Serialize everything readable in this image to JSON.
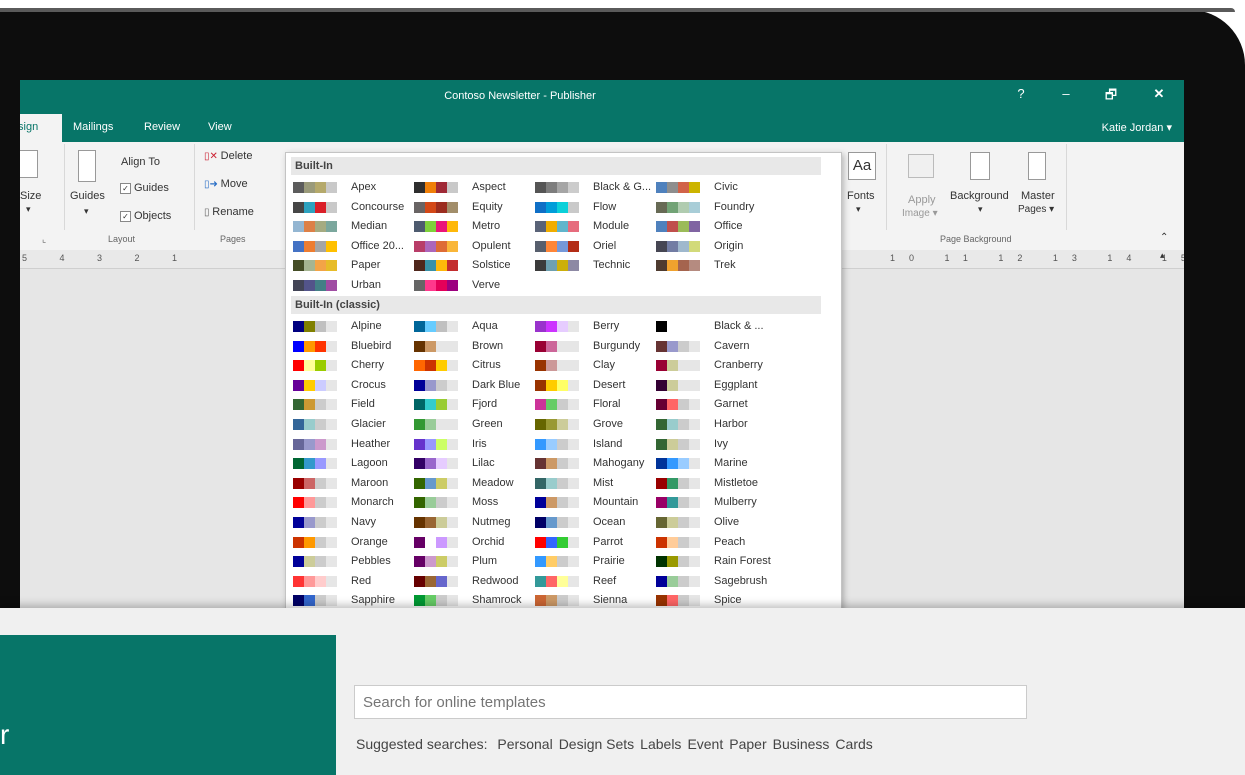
{
  "window": {
    "title": "Contoso Newsletter - Publisher",
    "help": "?",
    "minimize": "–",
    "restore": "🗗",
    "close": "✕"
  },
  "tabs": [
    {
      "label": "Design"
    },
    {
      "label": "Mailings"
    },
    {
      "label": "Review"
    },
    {
      "label": "View"
    }
  ],
  "user": "Katie Jordan ▾",
  "ribbon": {
    "size_label": "Size",
    "guides_label": "Guides",
    "align_to": "Align To",
    "guides_check": "Guides",
    "objects_check": "Objects",
    "layout_group": "Layout",
    "delete_label": "Delete",
    "move_label": "Move",
    "rename_label": "Rename",
    "pages_group": "Pages",
    "fonts_icon_text": "Aa",
    "fonts_label": "Fonts",
    "apply_image_label1": "Apply",
    "apply_image_label2": "Image ▾",
    "background_label": "Background",
    "master_pages_label1": "Master",
    "master_pages_label2": "Pages ▾",
    "page_background_group": "Page Background"
  },
  "ruler": {
    "left": "5  4  3  2  1",
    "right": "10  11  12  13  14  15"
  },
  "colors": {
    "accent": "#077568"
  },
  "dropdown": {
    "builtin_header": "Built-In",
    "classic_header": "Built-In (classic)",
    "builtin": [
      {
        "name": "Apex",
        "colors": [
          "#5c5c5c",
          "#9a9a7a",
          "#b5a96b",
          "#c9c9c9"
        ]
      },
      {
        "name": "Aspect",
        "colors": [
          "#2e2e2e",
          "#f07f09",
          "#9f2936",
          "#c9c9c9"
        ]
      },
      {
        "name": "Black & G...",
        "colors": [
          "#555555",
          "#7d7d7d",
          "#a5a5a5",
          "#cccccc"
        ]
      },
      {
        "name": "Civic",
        "colors": [
          "#4f81bd",
          "#8e8e8e",
          "#d16349",
          "#ccb400"
        ]
      },
      {
        "name": "Concourse",
        "colors": [
          "#464646",
          "#2da2bf",
          "#da1f28",
          "#c9c9c9"
        ]
      },
      {
        "name": "Equity",
        "colors": [
          "#696464",
          "#d34817",
          "#9b2d1f",
          "#a28e6a"
        ]
      },
      {
        "name": "Flow",
        "colors": [
          "#0f6fc6",
          "#009dd9",
          "#0bd0d9",
          "#c9c9c9"
        ]
      },
      {
        "name": "Foundry",
        "colors": [
          "#676a55",
          "#72a376",
          "#b0ccb0",
          "#a8cdd7"
        ]
      },
      {
        "name": "Median",
        "colors": [
          "#94b6d2",
          "#dd8047",
          "#a5ab81",
          "#7ba79d"
        ]
      },
      {
        "name": "Metro",
        "colors": [
          "#4e5b6f",
          "#7fd13b",
          "#ea157a",
          "#feb80a"
        ]
      },
      {
        "name": "Module",
        "colors": [
          "#5a6378",
          "#f0ad00",
          "#60b5cc",
          "#e66c7d"
        ]
      },
      {
        "name": "Office",
        "colors": [
          "#4f81bd",
          "#c0504d",
          "#9bbb59",
          "#8064a2"
        ]
      },
      {
        "name": "Office 20...",
        "colors": [
          "#4472c4",
          "#ed7d31",
          "#a5a5a5",
          "#ffc000"
        ]
      },
      {
        "name": "Opulent",
        "colors": [
          "#b83d68",
          "#ac66bb",
          "#de6c36",
          "#f9b639"
        ]
      },
      {
        "name": "Oriel",
        "colors": [
          "#575f6d",
          "#fe8637",
          "#7598d9",
          "#b32c16"
        ]
      },
      {
        "name": "Origin",
        "colors": [
          "#464653",
          "#727ca3",
          "#9fb8cd",
          "#d2da7a"
        ]
      },
      {
        "name": "Paper",
        "colors": [
          "#444d26",
          "#a5b592",
          "#f3a447",
          "#e7bc29"
        ]
      },
      {
        "name": "Solstice",
        "colors": [
          "#4f271c",
          "#3891a7",
          "#feb80a",
          "#c32d2e"
        ]
      },
      {
        "name": "Technic",
        "colors": [
          "#3b3b3b",
          "#6ea0b0",
          "#ccaf0a",
          "#8d89a4"
        ]
      },
      {
        "name": "Trek",
        "colors": [
          "#4e3b30",
          "#f0a22e",
          "#a5644e",
          "#b58b80"
        ]
      },
      {
        "name": "Urban",
        "colors": [
          "#424456",
          "#53548a",
          "#438086",
          "#a04da3"
        ]
      },
      {
        "name": "Verve",
        "colors": [
          "#666666",
          "#ff388c",
          "#e40059",
          "#9c007f"
        ]
      }
    ],
    "classic": [
      {
        "name": "Alpine",
        "colors": [
          "#000080",
          "#808000",
          "#c0c0c0",
          "#e6e6e6"
        ]
      },
      {
        "name": "Aqua",
        "colors": [
          "#006699",
          "#66ccff",
          "#c0c0c0",
          "#e6e6e6"
        ]
      },
      {
        "name": "Berry",
        "colors": [
          "#9933cc",
          "#cc33ff",
          "#e6ccff",
          "#e6e6e6"
        ]
      },
      {
        "name": "Black & ...",
        "colors": [
          "#000000",
          "#ffffff",
          "#ffffff",
          "#ffffff"
        ]
      },
      {
        "name": "Bluebird",
        "colors": [
          "#0000ff",
          "#ff9900",
          "#ff3300",
          "#e6e6e6"
        ]
      },
      {
        "name": "Brown",
        "colors": [
          "#663300",
          "#cc9966",
          "#e6e6e6",
          "#e6e6e6"
        ]
      },
      {
        "name": "Burgundy",
        "colors": [
          "#990033",
          "#cc6699",
          "#e6e6e6",
          "#e6e6e6"
        ]
      },
      {
        "name": "Cavern",
        "colors": [
          "#663333",
          "#9999cc",
          "#cccccc",
          "#e6e6e6"
        ]
      },
      {
        "name": "Cherry",
        "colors": [
          "#ff0000",
          "#ffff99",
          "#99cc00",
          "#e6e6e6"
        ]
      },
      {
        "name": "Citrus",
        "colors": [
          "#ff6600",
          "#cc3300",
          "#ffcc00",
          "#e6e6e6"
        ]
      },
      {
        "name": "Clay",
        "colors": [
          "#993300",
          "#cc9999",
          "#e6e6e6",
          "#e6e6e6"
        ]
      },
      {
        "name": "Cranberry",
        "colors": [
          "#990033",
          "#cccc99",
          "#e6e6e6",
          "#e6e6e6"
        ]
      },
      {
        "name": "Crocus",
        "colors": [
          "#660099",
          "#ffcc00",
          "#ccccff",
          "#e6e6e6"
        ]
      },
      {
        "name": "Dark Blue",
        "colors": [
          "#000099",
          "#9999cc",
          "#cccccc",
          "#e6e6e6"
        ]
      },
      {
        "name": "Desert",
        "colors": [
          "#993300",
          "#ffcc00",
          "#ffff66",
          "#e6e6e6"
        ]
      },
      {
        "name": "Eggplant",
        "colors": [
          "#330033",
          "#cccc99",
          "#e6e6e6",
          "#e6e6e6"
        ]
      },
      {
        "name": "Field",
        "colors": [
          "#336633",
          "#cc9933",
          "#cccccc",
          "#e6e6e6"
        ]
      },
      {
        "name": "Fjord",
        "colors": [
          "#006666",
          "#33cccc",
          "#99cc33",
          "#e6e6e6"
        ]
      },
      {
        "name": "Floral",
        "colors": [
          "#cc3399",
          "#66cc66",
          "#cccccc",
          "#e6e6e6"
        ]
      },
      {
        "name": "Garnet",
        "colors": [
          "#660033",
          "#ff6666",
          "#cccccc",
          "#e6e6e6"
        ]
      },
      {
        "name": "Glacier",
        "colors": [
          "#336699",
          "#99cccc",
          "#cccccc",
          "#e6e6e6"
        ]
      },
      {
        "name": "Green",
        "colors": [
          "#339933",
          "#99cc99",
          "#e6e6e6",
          "#e6e6e6"
        ]
      },
      {
        "name": "Grove",
        "colors": [
          "#666600",
          "#999933",
          "#cccc99",
          "#e6e6e6"
        ]
      },
      {
        "name": "Harbor",
        "colors": [
          "#336633",
          "#99cccc",
          "#cccccc",
          "#e6e6e6"
        ]
      },
      {
        "name": "Heather",
        "colors": [
          "#666699",
          "#9999cc",
          "#cc99cc",
          "#e6e6e6"
        ]
      },
      {
        "name": "Iris",
        "colors": [
          "#6633cc",
          "#9999ff",
          "#ccff66",
          "#e6e6e6"
        ]
      },
      {
        "name": "Island",
        "colors": [
          "#3399ff",
          "#99ccff",
          "#cccccc",
          "#e6e6e6"
        ]
      },
      {
        "name": "Ivy",
        "colors": [
          "#336633",
          "#cccc99",
          "#cccccc",
          "#e6e6e6"
        ]
      },
      {
        "name": "Lagoon",
        "colors": [
          "#006633",
          "#3399cc",
          "#9999ff",
          "#e6e6e6"
        ]
      },
      {
        "name": "Lilac",
        "colors": [
          "#330066",
          "#9966cc",
          "#e6ccff",
          "#e6e6e6"
        ]
      },
      {
        "name": "Mahogany",
        "colors": [
          "#663333",
          "#cc9966",
          "#cccccc",
          "#e6e6e6"
        ]
      },
      {
        "name": "Marine",
        "colors": [
          "#003399",
          "#3399ff",
          "#99ccff",
          "#e6e6e6"
        ]
      },
      {
        "name": "Maroon",
        "colors": [
          "#990000",
          "#cc6666",
          "#cccccc",
          "#e6e6e6"
        ]
      },
      {
        "name": "Meadow",
        "colors": [
          "#336600",
          "#6699cc",
          "#cccc66",
          "#e6e6e6"
        ]
      },
      {
        "name": "Mist",
        "colors": [
          "#336666",
          "#99cccc",
          "#cccccc",
          "#e6e6e6"
        ]
      },
      {
        "name": "Mistletoe",
        "colors": [
          "#990000",
          "#339966",
          "#cccccc",
          "#e6e6e6"
        ]
      },
      {
        "name": "Monarch",
        "colors": [
          "#ff0000",
          "#ff9999",
          "#cccccc",
          "#e6e6e6"
        ]
      },
      {
        "name": "Moss",
        "colors": [
          "#336600",
          "#99cc99",
          "#cccccc",
          "#e6e6e6"
        ]
      },
      {
        "name": "Mountain",
        "colors": [
          "#000099",
          "#cc9966",
          "#cccccc",
          "#e6e6e6"
        ]
      },
      {
        "name": "Mulberry",
        "colors": [
          "#990066",
          "#339999",
          "#cccccc",
          "#e6e6e6"
        ]
      },
      {
        "name": "Navy",
        "colors": [
          "#000099",
          "#9999cc",
          "#cccccc",
          "#e6e6e6"
        ]
      },
      {
        "name": "Nutmeg",
        "colors": [
          "#663300",
          "#996633",
          "#cccc99",
          "#e6e6e6"
        ]
      },
      {
        "name": "Ocean",
        "colors": [
          "#000066",
          "#6699cc",
          "#cccccc",
          "#e6e6e6"
        ]
      },
      {
        "name": "Olive",
        "colors": [
          "#666633",
          "#cccc99",
          "#cccccc",
          "#e6e6e6"
        ]
      },
      {
        "name": "Orange",
        "colors": [
          "#cc3300",
          "#ff9900",
          "#cccccc",
          "#e6e6e6"
        ]
      },
      {
        "name": "Orchid",
        "colors": [
          "#660066",
          "#ffffff",
          "#cc99ff",
          "#e6e6e6"
        ]
      },
      {
        "name": "Parrot",
        "colors": [
          "#ff0000",
          "#3366ff",
          "#33cc33",
          "#e6e6e6"
        ]
      },
      {
        "name": "Peach",
        "colors": [
          "#cc3300",
          "#ffcc99",
          "#cccccc",
          "#e6e6e6"
        ]
      },
      {
        "name": "Pebbles",
        "colors": [
          "#000099",
          "#cccc99",
          "#cccccc",
          "#e6e6e6"
        ]
      },
      {
        "name": "Plum",
        "colors": [
          "#660066",
          "#cc99cc",
          "#cccc66",
          "#e6e6e6"
        ]
      },
      {
        "name": "Prairie",
        "colors": [
          "#3399ff",
          "#ffcc66",
          "#cccccc",
          "#e6e6e6"
        ]
      },
      {
        "name": "Rain Forest",
        "colors": [
          "#003300",
          "#999900",
          "#cccccc",
          "#e6e6e6"
        ]
      },
      {
        "name": "Red",
        "colors": [
          "#ff3333",
          "#ff9999",
          "#ffcccc",
          "#e6e6e6"
        ]
      },
      {
        "name": "Redwood",
        "colors": [
          "#660000",
          "#996633",
          "#6666cc",
          "#e6e6e6"
        ]
      },
      {
        "name": "Reef",
        "colors": [
          "#339999",
          "#ff6666",
          "#ffff99",
          "#e6e6e6"
        ]
      },
      {
        "name": "Sagebrush",
        "colors": [
          "#000099",
          "#99cc99",
          "#cccccc",
          "#e6e6e6"
        ]
      },
      {
        "name": "Sapphire",
        "colors": [
          "#000066",
          "#3366cc",
          "#cccccc",
          "#e6e6e6"
        ]
      },
      {
        "name": "Shamrock",
        "colors": [
          "#009933",
          "#66cc66",
          "#cccccc",
          "#e6e6e6"
        ]
      },
      {
        "name": "Sienna",
        "colors": [
          "#cc6633",
          "#cc9966",
          "#cccccc",
          "#e6e6e6"
        ]
      },
      {
        "name": "Spice",
        "colors": [
          "#993300",
          "#ff6666",
          "#cccccc",
          "#e6e6e6"
        ]
      }
    ]
  },
  "backstage": {
    "letter": "r",
    "search_placeholder": "Search for online templates",
    "suggested_label": "Suggested searches:",
    "suggestions": [
      "Personal",
      "Design Sets",
      "Labels",
      "Event",
      "Paper",
      "Business",
      "Cards"
    ]
  }
}
